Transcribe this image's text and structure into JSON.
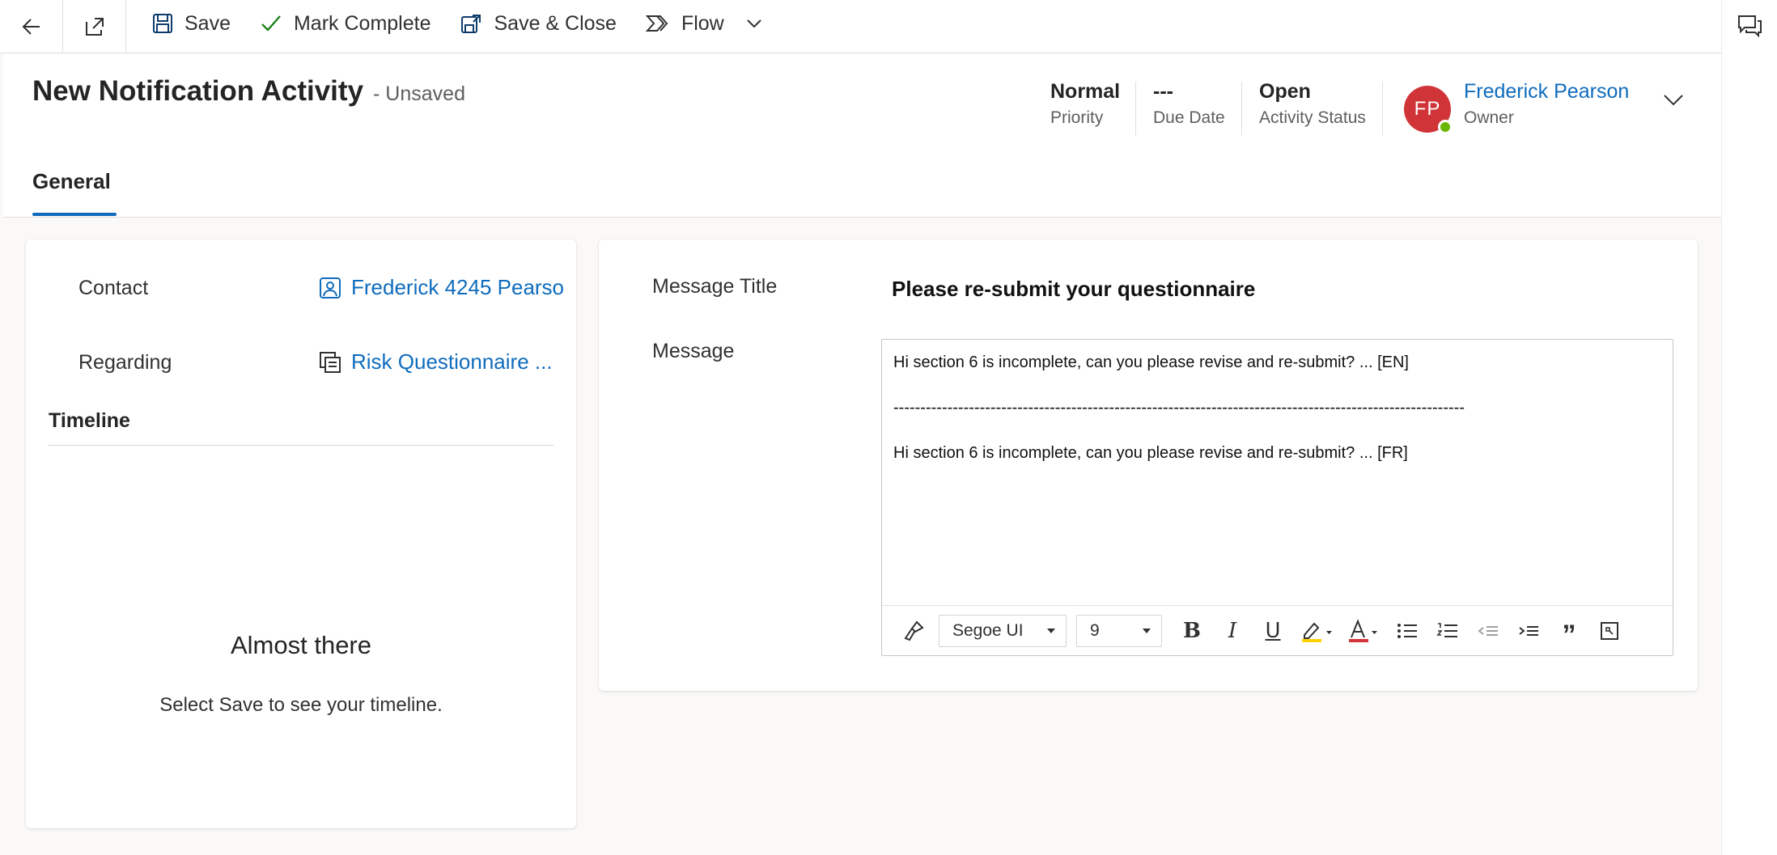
{
  "command_bar": {
    "back_icon": "back-arrow-icon",
    "popout_icon": "open-in-new-window-icon",
    "save_label": "Save",
    "mark_complete_label": "Mark Complete",
    "save_close_label": "Save & Close",
    "flow_label": "Flow"
  },
  "header": {
    "title": "New Notification Activity",
    "status_suffix": "- Unsaved",
    "priority": {
      "value": "Normal",
      "label": "Priority"
    },
    "due_date": {
      "value": "---",
      "label": "Due Date"
    },
    "activity_status": {
      "value": "Open",
      "label": "Activity Status"
    },
    "owner": {
      "initials": "FP",
      "name": "Frederick Pearson",
      "label": "Owner",
      "avatar_color": "#d13438",
      "presence_color": "#6bb700"
    }
  },
  "tabs": [
    {
      "label": "General",
      "selected": true
    }
  ],
  "left_card": {
    "contact": {
      "label": "Contact",
      "value": "Frederick 4245 Pearso"
    },
    "regarding": {
      "label": "Regarding",
      "value": "Risk Questionnaire ..."
    },
    "timeline": {
      "title": "Timeline",
      "empty_title": "Almost there",
      "empty_message": "Select Save to see your timeline."
    }
  },
  "right_card": {
    "message_title": {
      "label": "Message Title",
      "value": "Please re-submit your questionnaire"
    },
    "message": {
      "label": "Message",
      "line_en": "Hi section 6 is incomplete, can you please revise and re-submit? ... [EN]",
      "divider": "----------------------------------------------------------------------------------------------------------",
      "line_fr": "Hi section 6 is incomplete, can you please revise and re-submit? ... [FR]"
    },
    "toolbar": {
      "font_family": "Segoe UI",
      "font_size": "9",
      "bold_label": "B",
      "italic_label": "I",
      "underline_label": "U",
      "quote_label": "”"
    }
  },
  "colors": {
    "accent": "#0f6cbd",
    "complete_check": "#107c10"
  }
}
